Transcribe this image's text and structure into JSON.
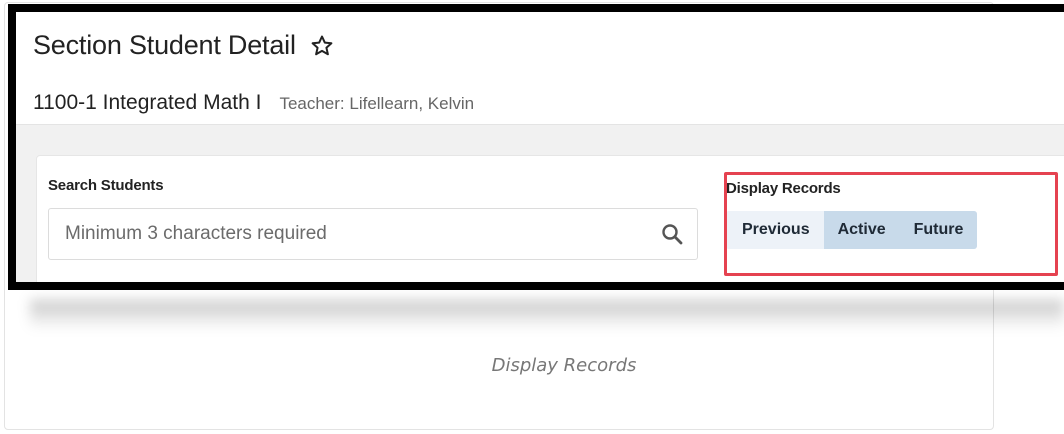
{
  "screenshot": {
    "page_title": "Section Student Detail",
    "section_name": "1100-1 Integrated Math I",
    "teacher": "Teacher: Lifellearn, Kelvin",
    "search": {
      "label": "Search Students",
      "placeholder": "Minimum 3 characters required",
      "value": ""
    },
    "display_records": {
      "label": "Display Records",
      "options": [
        "Previous",
        "Active",
        "Future"
      ],
      "selected": [
        "Active",
        "Future"
      ]
    }
  },
  "caption": "Display Records",
  "colors": {
    "highlight": "#e54250",
    "selected_toggle": "#c8daea",
    "frame_border": "#000000"
  },
  "icons": {
    "favorite": "star-outline-icon",
    "search": "search-icon"
  }
}
